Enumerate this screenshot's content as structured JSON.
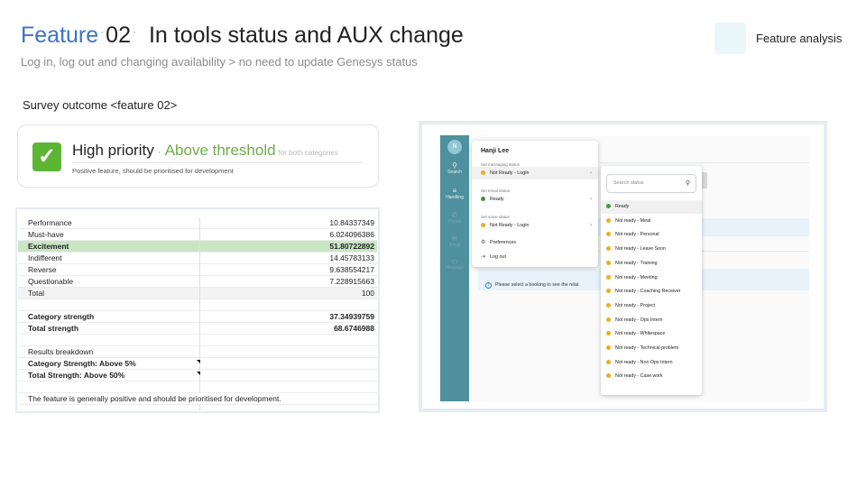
{
  "header": {
    "feature_word": "Feature",
    "dot": "·",
    "feature_number": "02",
    "title": "In tools status and AUX change",
    "subtitle": "Log in, log out and changing availability > no need to update Genesys status",
    "tag_label": "Feature analysis",
    "tag_color": "#e9f7fb"
  },
  "survey": {
    "heading": "Survey outcome <feature 02>",
    "priority": {
      "icon": "check-mark-icon",
      "label": "High priority",
      "separator": "·",
      "status": "Above threshold",
      "qualifier": "for both categories",
      "description": "Positive feature, should be prioritised for development",
      "accent_color": "#70ad47"
    }
  },
  "sheet": {
    "rows": [
      {
        "label": "Performance",
        "value": "10.84337349"
      },
      {
        "label": "Must-have",
        "value": "6.024096386"
      },
      {
        "label": "Excitement",
        "value": "51.80722892"
      },
      {
        "label": "Indifferent",
        "value": "14.45783133"
      },
      {
        "label": "Reverse",
        "value": "9.638554217"
      },
      {
        "label": "Questionable",
        "value": "7.228915663"
      },
      {
        "label": "Total",
        "value": "100"
      },
      {
        "label": "",
        "value": ""
      },
      {
        "label": "Category strength",
        "value": "37.34939759"
      },
      {
        "label": "Total strength",
        "value": "68.6746988"
      },
      {
        "label": "",
        "value": ""
      },
      {
        "label": "Results breakdown",
        "value": ""
      },
      {
        "label": "Category Strength: Above 5%",
        "value": ""
      },
      {
        "label": "Total Strength: Above 50%",
        "value": ""
      },
      {
        "label": "",
        "value": ""
      },
      {
        "label": "The feature is generally positive and should be prioritised for development.",
        "value": ""
      },
      {
        "label": "",
        "value": ""
      }
    ],
    "highlight_color": "#c9e5c4"
  },
  "app": {
    "avatar_initial": "N",
    "rail": [
      {
        "icon": "search-icon",
        "glyph": "⚲",
        "label": "Search"
      },
      {
        "icon": "handling-icon",
        "glyph": "≡",
        "label": "Handling"
      },
      {
        "icon": "phone-icon",
        "glyph": "✆",
        "label": "Phone"
      },
      {
        "icon": "email-icon",
        "glyph": "✉",
        "label": "Email"
      },
      {
        "icon": "message-icon",
        "glyph": "▭",
        "label": "Message"
      }
    ],
    "info_text": "Please select a booking to see the relat",
    "menu": {
      "user_name": "Hanji Lee",
      "messaging_section": "Set messaging status",
      "messaging_value": "Not Ready - Login",
      "email_section": "Set email status",
      "email_value": "Ready",
      "voice_section": "Set voice status",
      "voice_value": "Not Ready - Login",
      "preferences": "Preferences",
      "logout": "Log out"
    },
    "submenu": {
      "search_placeholder": "Search status",
      "items": [
        {
          "label": "Ready",
          "status": "ready"
        },
        {
          "label": "Not ready - Meal",
          "status": "not-ready"
        },
        {
          "label": "Not ready - Personal",
          "status": "not-ready"
        },
        {
          "label": "Not ready - Leave Soon",
          "status": "not-ready"
        },
        {
          "label": "Not ready - Training",
          "status": "not-ready"
        },
        {
          "label": "Not ready - Meeting",
          "status": "not-ready"
        },
        {
          "label": "Not ready - Coaching Receiver",
          "status": "not-ready"
        },
        {
          "label": "Not ready - Project",
          "status": "not-ready"
        },
        {
          "label": "Not ready - Ops Intern",
          "status": "not-ready"
        },
        {
          "label": "Not ready - Whitespace",
          "status": "not-ready"
        },
        {
          "label": "Not ready - Technical problem",
          "status": "not-ready"
        },
        {
          "label": "Not ready - Non Ops Intern",
          "status": "not-ready"
        },
        {
          "label": "Not ready - Case work",
          "status": "not-ready"
        }
      ]
    },
    "colors": {
      "rail": "#4f909f",
      "ready": "#3c9a3c",
      "not_ready": "#f0ad1c"
    }
  }
}
